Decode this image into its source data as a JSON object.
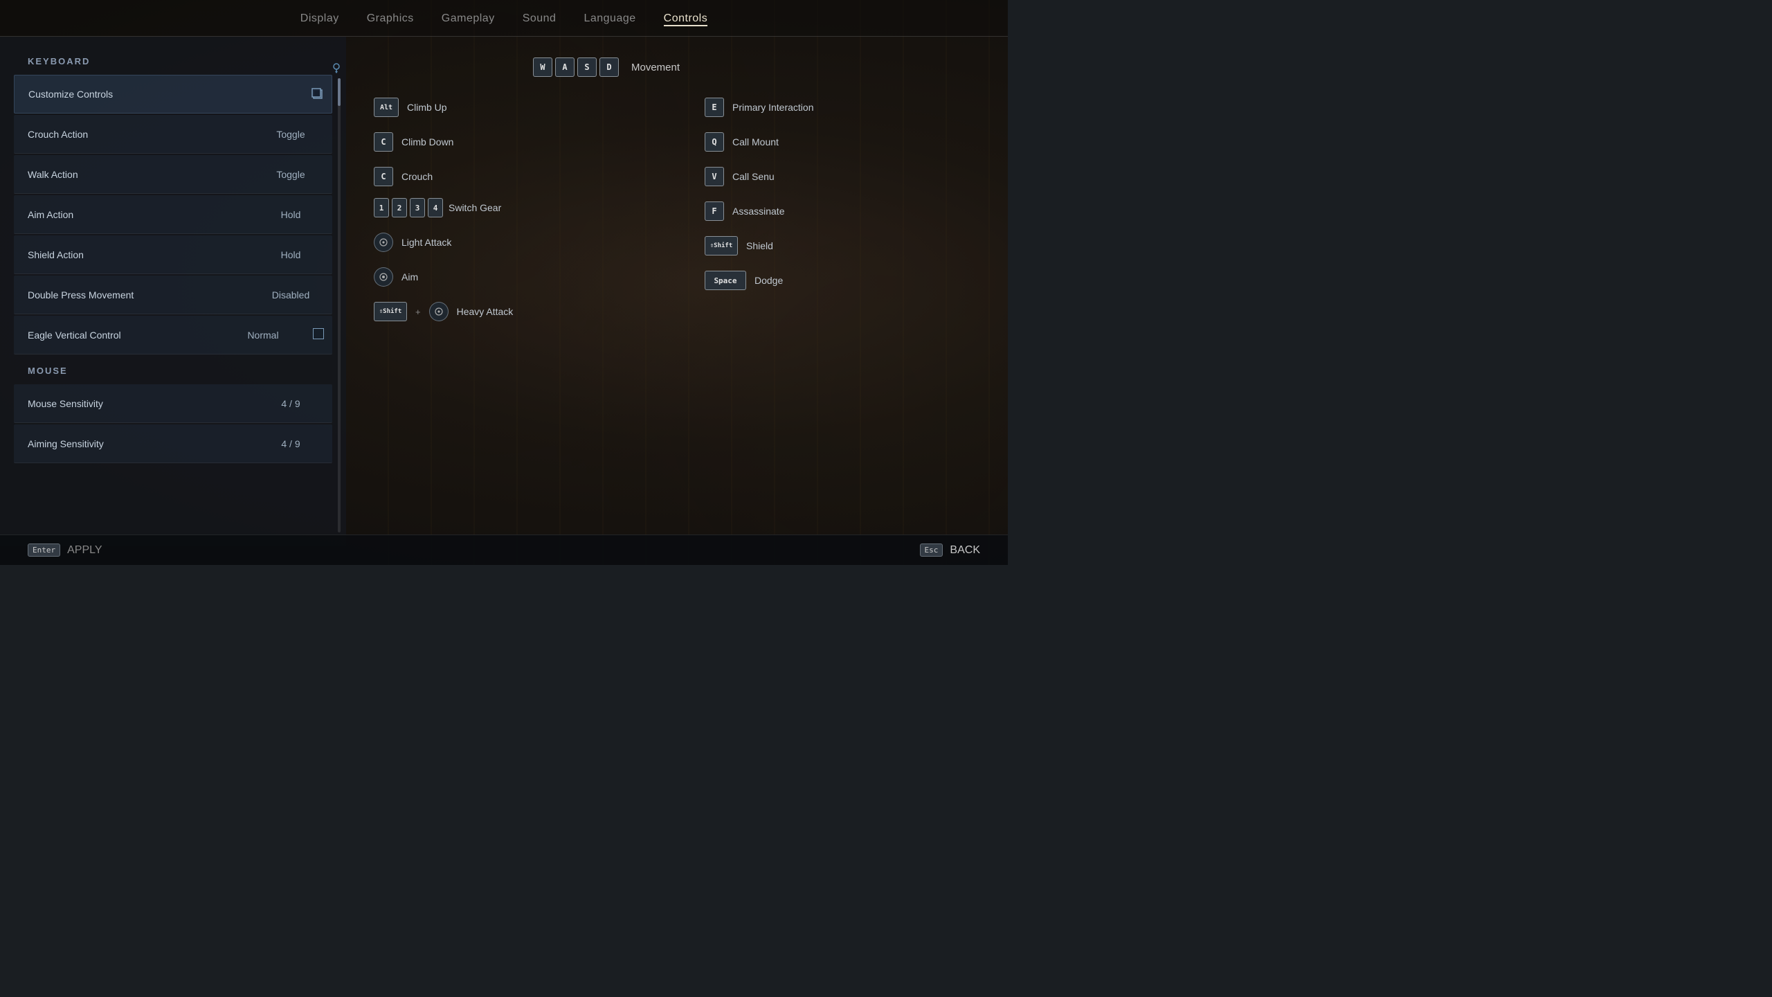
{
  "nav": {
    "items": [
      {
        "label": "Display",
        "active": false
      },
      {
        "label": "Graphics",
        "active": false
      },
      {
        "label": "Gameplay",
        "active": false
      },
      {
        "label": "Sound",
        "active": false
      },
      {
        "label": "Language",
        "active": false
      },
      {
        "label": "Controls",
        "active": true
      }
    ]
  },
  "sidebar": {
    "keyboard_label": "KEYBOARD",
    "mouse_label": "MOUSE",
    "keyboard_rows": [
      {
        "name": "Customize Controls",
        "value": "",
        "type": "header"
      },
      {
        "name": "Crouch Action",
        "value": "Toggle",
        "type": "normal"
      },
      {
        "name": "Walk Action",
        "value": "Toggle",
        "type": "normal"
      },
      {
        "name": "Aim Action",
        "value": "Hold",
        "type": "normal"
      },
      {
        "name": "Shield Action",
        "value": "Hold",
        "type": "normal"
      },
      {
        "name": "Double Press Movement",
        "value": "Disabled",
        "type": "normal"
      },
      {
        "name": "Eagle Vertical Control",
        "value": "Normal",
        "type": "checkbox"
      }
    ],
    "mouse_rows": [
      {
        "name": "Mouse Sensitivity",
        "value": "4 / 9",
        "type": "normal"
      },
      {
        "name": "Aiming Sensitivity",
        "value": "4 / 9",
        "type": "normal"
      }
    ]
  },
  "keybindings": {
    "movement_keys": [
      "W",
      "A",
      "S",
      "D"
    ],
    "movement_label": "Movement",
    "left_column": [
      {
        "key": "Alt",
        "label": "Climb Up"
      },
      {
        "key": "C",
        "label": "Climb Down"
      },
      {
        "key": "C",
        "label": "Crouch"
      },
      {
        "keys": [
          "1",
          "2",
          "3",
          "4"
        ],
        "label": "Switch Gear",
        "type": "num"
      },
      {
        "controller": "LMB",
        "label": "Light Attack",
        "icon": true
      },
      {
        "controller": "RMB",
        "label": "Aim",
        "icon": true
      },
      {
        "key_shift": "⇧Shift",
        "plus": "+",
        "controller": "LMB",
        "label": "Heavy Attack",
        "icon": true
      }
    ],
    "right_column": [
      {
        "key": "E",
        "label": "Primary Interaction"
      },
      {
        "key": "Q",
        "label": "Call Mount"
      },
      {
        "key": "V",
        "label": "Call Senu"
      },
      {
        "key": "F",
        "label": "Assassinate"
      },
      {
        "key": "⇧Shift",
        "label": "Shield",
        "shift": true
      },
      {
        "key": "Space",
        "label": "Dodge",
        "space": true
      }
    ]
  },
  "bottom": {
    "apply_label": "APPLY",
    "back_label": "BACK",
    "apply_key": "Enter",
    "back_key": "Esc"
  }
}
